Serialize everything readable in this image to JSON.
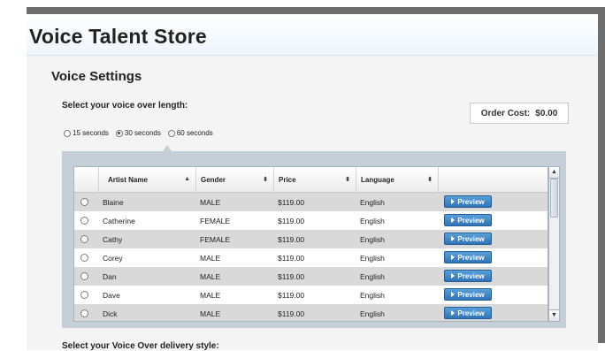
{
  "store": {
    "title": "Voice Talent Store"
  },
  "section": {
    "title": "Voice Settings"
  },
  "length": {
    "prompt": "Select your voice over length:",
    "options": [
      {
        "label": "15 seconds",
        "selected": false
      },
      {
        "label": "30 seconds",
        "selected": true
      },
      {
        "label": "60 seconds",
        "selected": false
      }
    ]
  },
  "order": {
    "label": "Order Cost:",
    "value": "$0.00"
  },
  "table": {
    "headers": [
      "Artist Name",
      "Gender",
      "Price",
      "Language"
    ],
    "rows": [
      {
        "name": "Blaine",
        "gender": "MALE",
        "price": "$119.00",
        "language": "English",
        "action": "Preview"
      },
      {
        "name": "Catherine",
        "gender": "FEMALE",
        "price": "$119.00",
        "language": "English",
        "action": "Preview"
      },
      {
        "name": "Cathy",
        "gender": "FEMALE",
        "price": "$119.00",
        "language": "English",
        "action": "Preview"
      },
      {
        "name": "Corey",
        "gender": "MALE",
        "price": "$119.00",
        "language": "English",
        "action": "Preview"
      },
      {
        "name": "Dan",
        "gender": "MALE",
        "price": "$119.00",
        "language": "English",
        "action": "Preview"
      },
      {
        "name": "Dave",
        "gender": "MALE",
        "price": "$119.00",
        "language": "English",
        "action": "Preview"
      },
      {
        "name": "Dick",
        "gender": "MALE",
        "price": "$119.00",
        "language": "English",
        "action": "Preview"
      }
    ]
  },
  "delivery": {
    "prompt": "Select your Voice Over delivery style:"
  },
  "icons": {
    "sort_asc": "sort-ascending-icon",
    "sort_both": "sort-both-icon",
    "play": "play-icon"
  },
  "colors": {
    "preview_button": "#3a82c4",
    "row_shade": "#d9d9d9",
    "grid_frame": "#c6cfd8"
  }
}
